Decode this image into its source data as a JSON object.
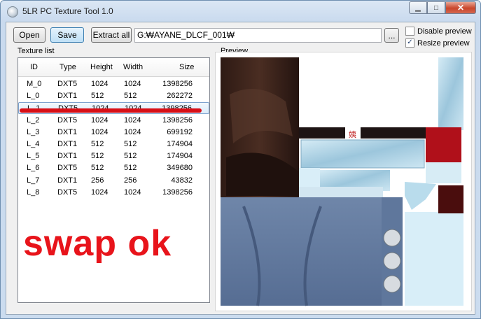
{
  "window": {
    "title": "5LR PC Texture Tool 1.0",
    "min_symbol": "▁",
    "max_symbol": "□",
    "close_symbol": "✕"
  },
  "toolbar": {
    "open_label": "Open",
    "save_label": "Save",
    "extract_label": "Extract all",
    "path_value": "G:₩AYANE_DLCF_001₩",
    "browse_label": "...",
    "disable_preview_label": "Disable preview",
    "disable_preview_checked": false,
    "resize_preview_label": "Resize preview",
    "resize_preview_checked": true
  },
  "texture_list": {
    "label": "Texture list",
    "headers": [
      "ID",
      "Type",
      "Height",
      "Width",
      "Size"
    ],
    "rows": [
      [
        "M_0",
        "DXT5",
        "1024",
        "1024",
        "1398256"
      ],
      [
        "L_0",
        "DXT1",
        "512",
        "512",
        "262272"
      ],
      [
        "L_1",
        "DXT5",
        "1024",
        "1024",
        "1398256"
      ],
      [
        "L_2",
        "DXT5",
        "1024",
        "1024",
        "1398256"
      ],
      [
        "L_3",
        "DXT1",
        "1024",
        "1024",
        "699192"
      ],
      [
        "L_4",
        "DXT1",
        "512",
        "512",
        "174904"
      ],
      [
        "L_5",
        "DXT1",
        "512",
        "512",
        "174904"
      ],
      [
        "L_6",
        "DXT5",
        "512",
        "512",
        "349680"
      ],
      [
        "L_7",
        "DXT1",
        "256",
        "256",
        "43832"
      ],
      [
        "L_8",
        "DXT5",
        "1024",
        "1024",
        "1398256"
      ]
    ],
    "selected_id": "L_1"
  },
  "preview": {
    "label": "Preview",
    "glyph": "姨"
  },
  "annotation": {
    "text": "swap  ok"
  },
  "colors": {
    "annotation_red": "#e8141b",
    "selection_border": "#7da2ce"
  }
}
